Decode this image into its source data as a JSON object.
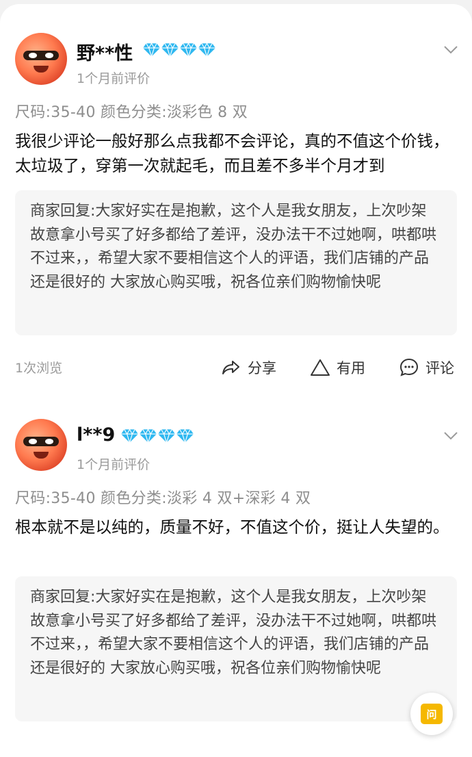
{
  "reviews": [
    {
      "username": "野**性",
      "time": "1个月前评价",
      "meta": "尺码:35-40 颜色分类:淡彩色 8 双",
      "content": "我很少评论一般好那么点我都不会评论，真的不值这个价钱，太垃圾了，穿第一次就起毛，而且差不多半个月才到",
      "reply": "商家回复:大家好实在是抱歉，这个人是我女朋友，上次吵架 故意拿小号买了好多都给了差评，没办法干不过她啊，哄都哄不过来，，希望大家不要相信这个人的评语，我们店铺的产品还是很好的 大家放心购买哦，祝各位亲们购物愉快呢"
    },
    {
      "username": "l**9",
      "time": "1个月前评价",
      "meta": "尺码:35-40 颜色分类:淡彩 4 双+深彩 4 双",
      "content": "根本就不是以纯的，质量不好，不值这个价，挺让人失望的。",
      "reply": "商家回复:大家好实在是抱歉，这个人是我女朋友，上次吵架 故意拿小号买了好多都给了差评，没办法干不过她啊，哄都哄不过来，，希望大家不要相信这个人的评语，我们店铺的产品还是很好的 大家放心购买哦，祝各位亲们购物愉快呢"
    }
  ],
  "actions": {
    "views": "1次浏览",
    "share": "分享",
    "useful": "有用",
    "comment": "评论"
  },
  "fab_label": "问",
  "colors": {
    "diamond": "#2fb8f0",
    "fab": "#f5b800"
  }
}
